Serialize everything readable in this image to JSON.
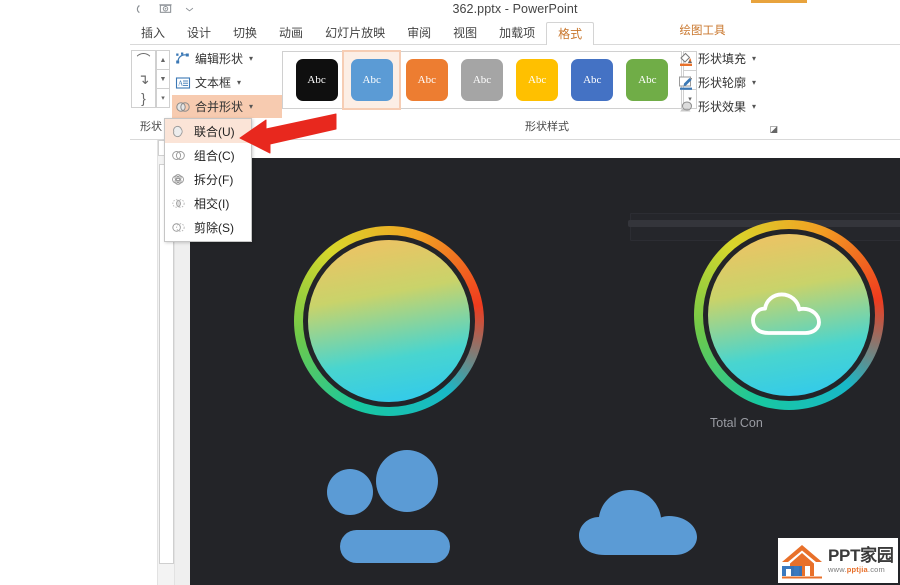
{
  "window": {
    "title": "362.pptx - PowerPoint",
    "quick_access": [
      "undo-icon",
      "slideshow-icon",
      "chevron-down-icon"
    ]
  },
  "tabs": {
    "items": [
      {
        "label": "插入",
        "active": false
      },
      {
        "label": "设计",
        "active": false
      },
      {
        "label": "切换",
        "active": false
      },
      {
        "label": "动画",
        "active": false
      },
      {
        "label": "幻灯片放映",
        "active": false
      },
      {
        "label": "审阅",
        "active": false
      },
      {
        "label": "视图",
        "active": false
      },
      {
        "label": "加载项",
        "active": false
      },
      {
        "label": "格式",
        "active": true
      }
    ],
    "contextual_label": "绘图工具"
  },
  "ribbon": {
    "groups": {
      "shapes": {
        "label": "形状",
        "gallery_glyphs": [
          "⌒",
          "↴",
          "}"
        ],
        "scroll_up": "▲",
        "scroll_down": "▼",
        "scroll_more": "▾"
      },
      "insert_shapes": {
        "items": [
          {
            "label": "编辑形状",
            "icon": "edit-shape-icon",
            "has_caret": true,
            "highlight": false
          },
          {
            "label": "文本框",
            "icon": "text-box-icon",
            "has_caret": true,
            "highlight": false
          },
          {
            "label": "合并形状",
            "icon": "merge-shapes-icon",
            "has_caret": true,
            "highlight": true
          }
        ]
      },
      "shape_styles": {
        "label": "形状样式",
        "swatches": [
          {
            "text": "Abc",
            "color": "#0f0f0f",
            "selected": false
          },
          {
            "text": "Abc",
            "color": "#5B9BD5",
            "selected": true
          },
          {
            "text": "Abc",
            "color": "#ED7D31",
            "selected": false
          },
          {
            "text": "Abc",
            "color": "#A5A5A5",
            "selected": false
          },
          {
            "text": "Abc",
            "color": "#FFC000",
            "selected": false
          },
          {
            "text": "Abc",
            "color": "#4472C4",
            "selected": false
          },
          {
            "text": "Abc",
            "color": "#70AD47",
            "selected": false
          }
        ],
        "dialog_launcher": "◪"
      },
      "shape_fill": {
        "items": [
          {
            "label": "形状填充",
            "icon": "fill-bucket-icon",
            "has_caret": true
          },
          {
            "label": "形状轮廓",
            "icon": "outline-pen-icon",
            "has_caret": true
          },
          {
            "label": "形状效果",
            "icon": "shape-effects-icon",
            "has_caret": true
          }
        ]
      }
    }
  },
  "merge_menu": {
    "items": [
      {
        "label": "联合(U)",
        "icon": "union-icon",
        "highlighted": true
      },
      {
        "label": "组合(C)",
        "icon": "combine-icon",
        "highlighted": false
      },
      {
        "label": "拆分(F)",
        "icon": "fragment-icon",
        "highlighted": false
      },
      {
        "label": "相交(I)",
        "icon": "intersect-icon",
        "highlighted": false
      },
      {
        "label": "剪除(S)",
        "icon": "subtract-icon",
        "highlighted": false
      }
    ]
  },
  "annotation": {
    "arrow_color": "#E8281E",
    "points_to": "联合(U)"
  },
  "slide": {
    "background": "#232428",
    "caption": "Total Con",
    "shapes": [
      {
        "name": "gradient-ring-circle-left",
        "icon": null
      },
      {
        "name": "gradient-ring-circle-right",
        "icon": "cloud-outline-icon"
      },
      {
        "name": "people-icon",
        "color": "#5B9BD5"
      },
      {
        "name": "cloud-icon",
        "color": "#5B9BD5"
      }
    ]
  },
  "watermark": {
    "brand": "PPT家园",
    "url_prefix": "www.",
    "url_mid": "pptjia",
    "url_suffix": ".com"
  }
}
